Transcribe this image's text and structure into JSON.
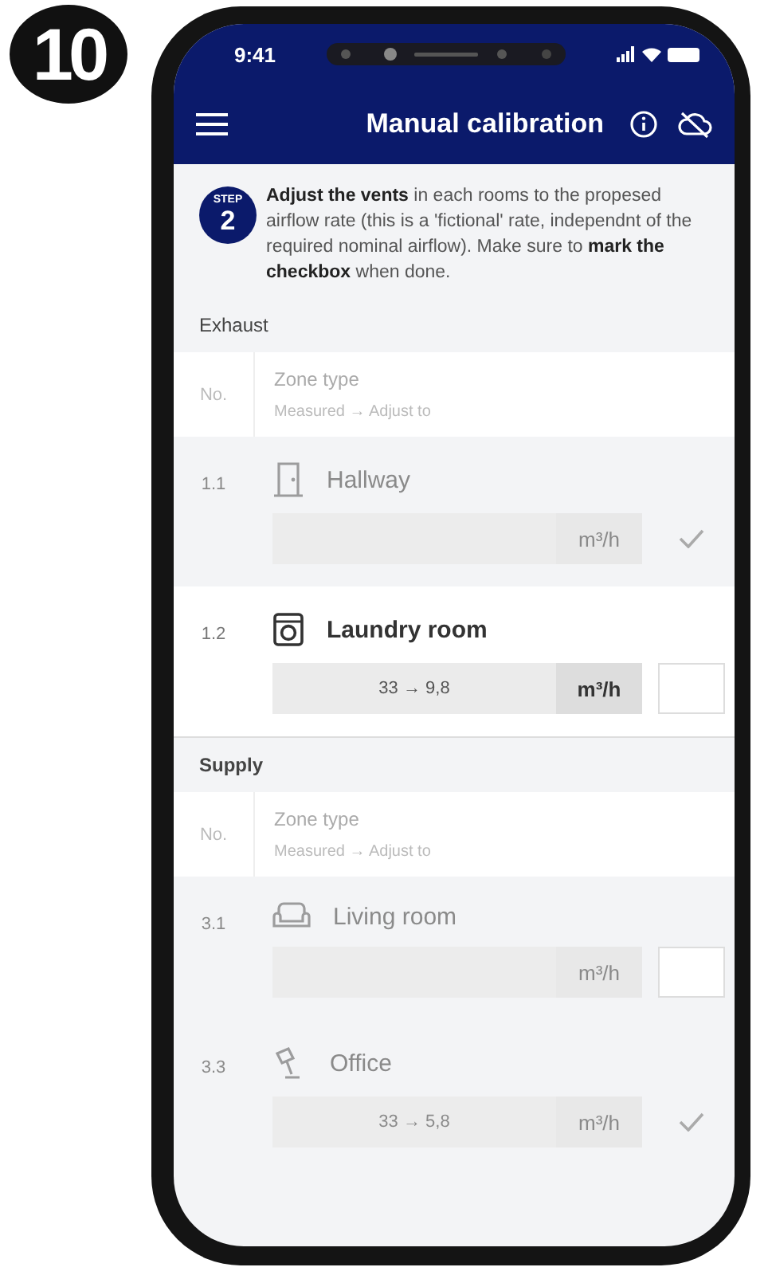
{
  "step_badge": "10",
  "status_bar": {
    "time": "9:41"
  },
  "app_bar": {
    "title": "Manual calibration"
  },
  "intro": {
    "step_label": "STEP",
    "step_number": "2",
    "text": "**Adjust the vents** in each rooms to the propesed airflow rate (this is a 'fictional' rate, independnt of the required nominal airflow). Make sure to **mark the checkbox** when done."
  },
  "sections": [
    {
      "title": "Exhaust",
      "columns": {
        "number": "No.",
        "zone": "Zone type",
        "sub": "Measured → Adjust to"
      },
      "rows": [
        {
          "number": "1.1",
          "name": "Hallway",
          "value": "",
          "unit": "m³/h",
          "active": false,
          "checked": true
        },
        {
          "number": "1.2",
          "name": "Laundry room",
          "value": "33 → 9,8",
          "unit": "m³/h",
          "active": true,
          "checked": false
        }
      ]
    },
    {
      "title": "Supply",
      "columns": {
        "number": "No.",
        "zone": "Zone type",
        "sub": "Measured → Adjust to"
      },
      "rows": [
        {
          "number": "3.1",
          "name": "Living room",
          "value": "",
          "unit": "m³/h",
          "active": false,
          "checked": false
        },
        {
          "number": "3.3",
          "name": "Office",
          "value": "33 → 5,8",
          "unit": "m³/h",
          "active": false,
          "checked": true
        }
      ]
    }
  ]
}
